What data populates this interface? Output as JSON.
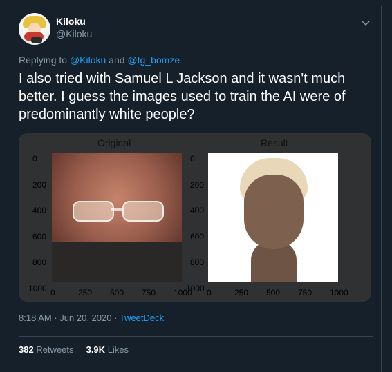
{
  "user": {
    "name": "Kiloku",
    "handle": "@Kiloku"
  },
  "replying": {
    "prefix": "Replying to",
    "mentions": [
      "@Kiloku",
      "@tg_bomze"
    ],
    "joiner": "and"
  },
  "tweet": {
    "text": "I also tried with Samuel L Jackson and it wasn't much better. I guess the images used to train the AI were of predominantly white people?"
  },
  "media": {
    "left_title": "Original",
    "right_title": "Result",
    "y_ticks": [
      "0",
      "200",
      "400",
      "600",
      "800",
      "1000"
    ],
    "x_ticks": [
      "0",
      "250",
      "500",
      "750",
      "1000"
    ]
  },
  "meta": {
    "time": "8:18 AM",
    "date": "Jun 20, 2020",
    "client": "TweetDeck"
  },
  "stats": {
    "retweets": "382",
    "retweets_label": "Retweets",
    "likes": "3.9K",
    "likes_label": "Likes"
  }
}
